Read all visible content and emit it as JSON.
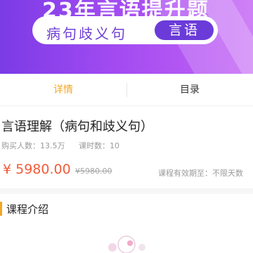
{
  "banner": {
    "top_text": "23年言语提升题",
    "pill_text": "病句歧义句",
    "badge_text": "言语"
  },
  "tabs": [
    {
      "label": "详情",
      "active": true
    },
    {
      "label": "目录",
      "active": false
    }
  ],
  "course": {
    "title": "言语理解（病句和歧义句）",
    "buyers": "购买人数：13.5万",
    "lessons": "课时数：10",
    "price": "¥ 5980.00",
    "original_price": "¥5980.00",
    "validity": "课程有效期至：不限天数"
  },
  "section": {
    "title": "课程介绍"
  },
  "colors": {
    "accent": "#f5a623",
    "price": "#f25b3a",
    "banner_purple": "#7b3be6"
  }
}
